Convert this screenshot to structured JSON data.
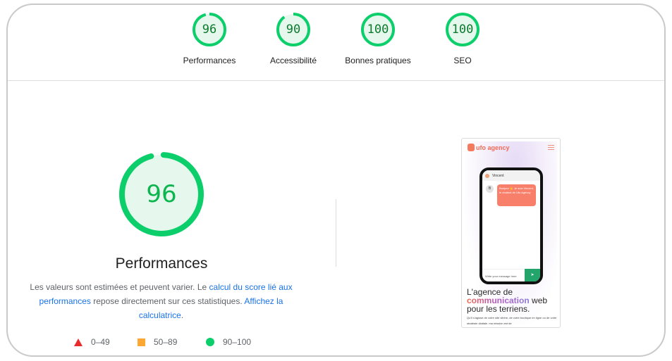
{
  "categories": [
    {
      "id": "performance",
      "label": "Performances",
      "score": "96",
      "value": 96
    },
    {
      "id": "accessibility",
      "label": "Accessibilité",
      "score": "90",
      "value": 90
    },
    {
      "id": "best-practices",
      "label": "Bonnes pratiques",
      "score": "100",
      "value": 100
    },
    {
      "id": "seo",
      "label": "SEO",
      "score": "100",
      "value": 100
    }
  ],
  "main": {
    "title": "Performances",
    "score": "96",
    "value": 96,
    "description": {
      "text_1": "Les valeurs sont estimées et peuvent varier. Le ",
      "link_1": "calcul du score lié aux performances",
      "text_2": " repose directement sur ces statistiques. ",
      "link_2": "Affichez la calculatrice",
      "text_3": "."
    },
    "legend": [
      {
        "icon": "triangle-icon",
        "range": "0–49",
        "color": "#e82c2c"
      },
      {
        "icon": "square-icon",
        "range": "50–89",
        "color": "#ffa733"
      },
      {
        "icon": "circle-icon",
        "range": "90–100",
        "color": "#0cce6b"
      }
    ]
  },
  "colors": {
    "pass_ring": "#0cce6b",
    "pass_fill": "#e6f8ed",
    "pass_text_small": "#0b7a2c",
    "pass_text_big": "#0cb54d",
    "link": "#1a73e8"
  },
  "thumbnail": {
    "logo_text": "ufo agency",
    "chat_name": "Vincent",
    "bubble_avatar": "B",
    "bubble_text": "Bonjour 👋 Je suis Vincent, le chatbot de Ufo Agency",
    "input_placeholder": "Write your message here",
    "send_icon": "➤",
    "headline_1": "L'agence de",
    "headline_grad": "communication",
    "headline_2": " web",
    "headline_3": "pour les terriens.",
    "body": "Qu'il s'agisse de votre site vitrine, de votre boutique en ligne ou de votre stratégie digitale, ma mission est de"
  }
}
